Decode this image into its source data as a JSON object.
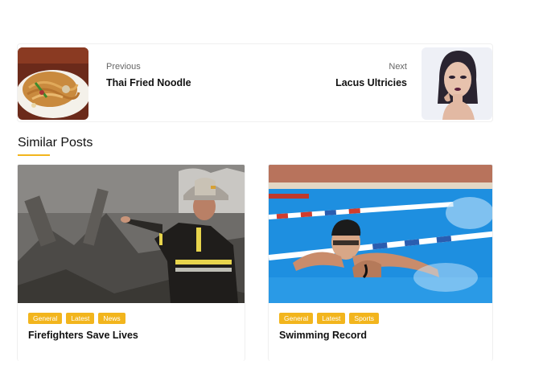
{
  "post_nav": {
    "previous": {
      "kicker": "Previous",
      "title": "Thai Fried Noodle"
    },
    "next": {
      "kicker": "Next",
      "title": "Lacus Ultricies"
    }
  },
  "similar": {
    "heading": "Similar Posts",
    "accent_color": "#f2b51d",
    "posts": [
      {
        "title": "Firefighters Save Lives",
        "tags": [
          "General",
          "Latest",
          "News"
        ]
      },
      {
        "title": "Swimming Record",
        "tags": [
          "General",
          "Latest",
          "Sports"
        ]
      }
    ]
  }
}
